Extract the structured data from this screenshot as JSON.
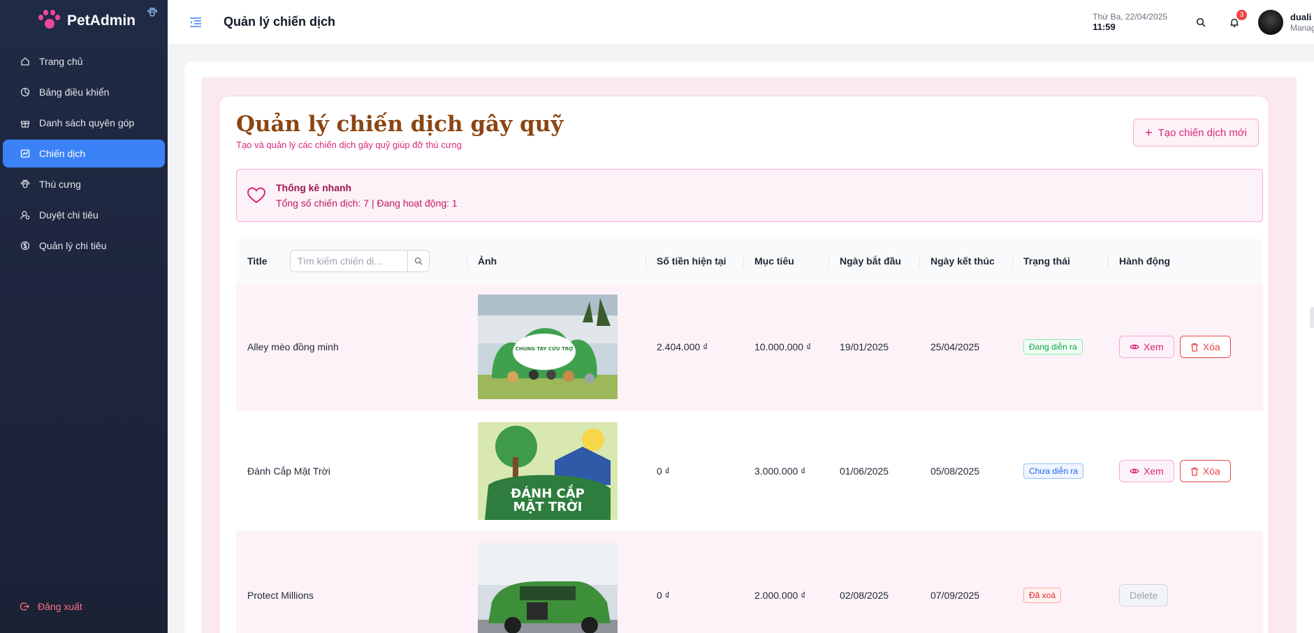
{
  "app": {
    "name": "PetAdmin"
  },
  "sidebar": {
    "items": [
      {
        "label": "Trang chủ",
        "icon": "home-icon"
      },
      {
        "label": "Bảng điều khiển",
        "icon": "pie-chart-icon"
      },
      {
        "label": "Danh sách quyên góp",
        "icon": "gift-icon"
      },
      {
        "label": "Chiến dịch",
        "icon": "fund-icon",
        "active": true
      },
      {
        "label": "Thú cưng",
        "icon": "paw-icon"
      },
      {
        "label": "Duyệt chi tiêu",
        "icon": "audit-icon"
      },
      {
        "label": "Quản lý chi tiêu",
        "icon": "dollar-icon"
      }
    ],
    "logout_label": "Đăng xuất"
  },
  "header": {
    "title": "Quản lý chiến dịch",
    "date": "Thứ Ba, 22/04/2025",
    "time": "11:59",
    "notification_count": "3",
    "user_name": "duali",
    "user_role": "Manag"
  },
  "page": {
    "title": "Quản lý chiến dịch gây quỹ",
    "subtitle": "Tạo và quản lý các chiến dịch gây quỹ giúp đỡ thú cưng",
    "create_button": "Tạo chiến dịch mới",
    "stats_title": "Thống kê nhanh",
    "stats_text": "Tổng số chiến dịch: 7 | Đang hoạt động: 1"
  },
  "table": {
    "search_placeholder": "Tìm kiếm chiến dị...",
    "columns": [
      "Title",
      "Ảnh",
      "Số tiền hiện tại",
      "Mục tiêu",
      "Ngày bắt đầu",
      "Ngày kết thúc",
      "Trạng thái",
      "Hành động"
    ],
    "rows": [
      {
        "title": "Alley mèo đồng minh",
        "current": "2.404.000 ₫",
        "goal": "10.000.000 ₫",
        "start": "19/01/2025",
        "end": "25/04/2025",
        "status": "Đang diễn ra",
        "status_color": "#16a34a",
        "view_label": "Xem",
        "delete_label": "Xóa"
      },
      {
        "title": "Đánh Cắp Mặt Trời",
        "current": "0 ₫",
        "goal": "3.000.000 ₫",
        "start": "01/06/2025",
        "end": "05/08/2025",
        "status": "Chưa diễn ra",
        "status_color": "#2563eb",
        "view_label": "Xem",
        "delete_label": "Xóa"
      },
      {
        "title": "Protect Millions",
        "current": "0 ₫",
        "goal": "2.000.000 ₫",
        "start": "02/08/2025",
        "end": "07/09/2025",
        "status": "Đã xoá",
        "status_color": "#dc2626",
        "disabled_label": "Delete"
      }
    ],
    "image_texts": {
      "row1": "CHUNG TAY CỨU TRỢ",
      "row2_line1": "ĐÁNH CẮP",
      "row2_line2": "MẶT TRỜI"
    }
  },
  "colors": {
    "sidebar_bg": "#1f2a44",
    "accent": "#3b82f6",
    "brand_pink": "#ec4899",
    "title_brown": "#8b4513"
  }
}
